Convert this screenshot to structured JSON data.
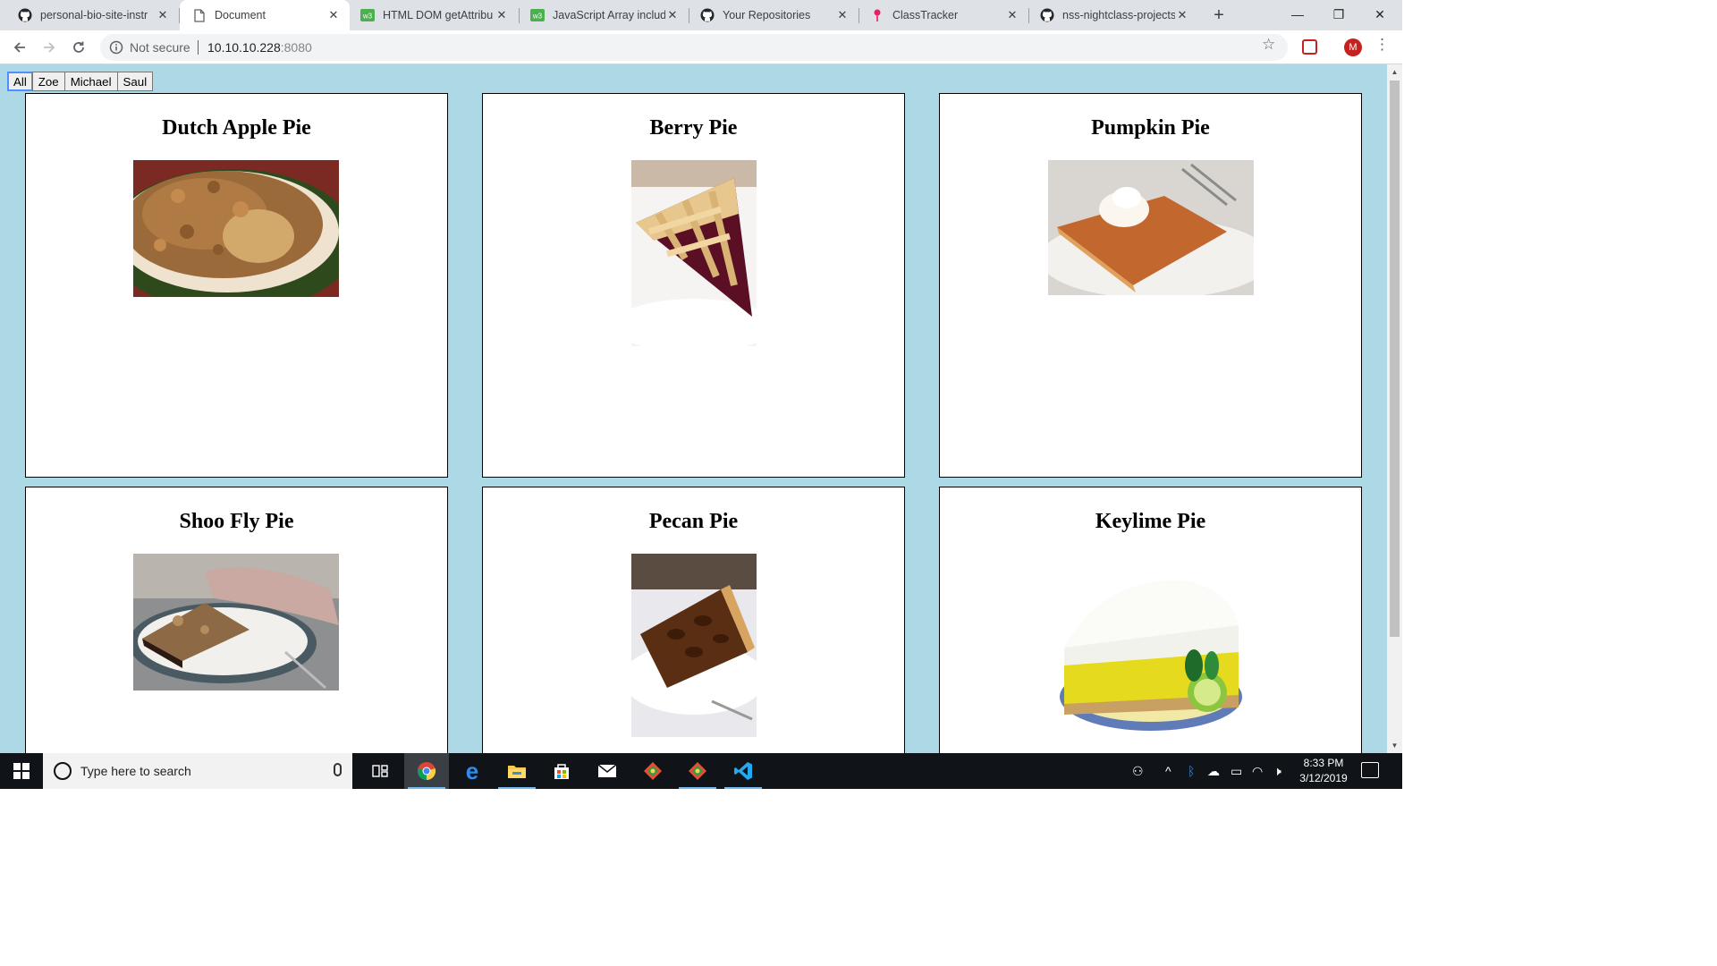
{
  "browser": {
    "tabs": [
      {
        "title": "personal-bio-site-instr",
        "icon": "github-icon",
        "active": false
      },
      {
        "title": "Document",
        "icon": "document-icon",
        "active": true
      },
      {
        "title": "HTML DOM getAttribu",
        "icon": "w3schools-icon",
        "active": false
      },
      {
        "title": "JavaScript Array includ",
        "icon": "w3schools-icon",
        "active": false
      },
      {
        "title": "Your Repositories",
        "icon": "github-icon",
        "active": false
      },
      {
        "title": "ClassTracker",
        "icon": "classtracker-icon",
        "active": false
      },
      {
        "title": "nss-nightclass-projects",
        "icon": "github-icon",
        "active": false
      }
    ],
    "close_glyph": "✕",
    "new_tab_glyph": "+",
    "window_controls": {
      "minimize": "—",
      "maximize": "❐",
      "close": "✕"
    },
    "address_bar": {
      "security_label": "Not secure",
      "host": "10.10.10.228",
      "port": ":8080"
    },
    "profile_initial": "M"
  },
  "page": {
    "filters": [
      {
        "label": "All",
        "active": true
      },
      {
        "label": "Zoe",
        "active": false
      },
      {
        "label": "Michael",
        "active": false
      },
      {
        "label": "Saul",
        "active": false
      }
    ],
    "pies": [
      {
        "name": "Dutch Apple Pie",
        "image": "dutch-apple-pie-photo"
      },
      {
        "name": "Berry Pie",
        "image": "berry-pie-photo"
      },
      {
        "name": "Pumpkin Pie",
        "image": "pumpkin-pie-photo"
      },
      {
        "name": "Shoo Fly Pie",
        "image": "shoo-fly-pie-photo"
      },
      {
        "name": "Pecan Pie",
        "image": "pecan-pie-photo"
      },
      {
        "name": "Keylime Pie",
        "image": "keylime-pie-photo"
      }
    ]
  },
  "taskbar": {
    "search_placeholder": "Type here to search",
    "apps": [
      "task-view-icon",
      "chrome-icon",
      "edge-icon",
      "file-explorer-icon",
      "store-icon",
      "mail-icon",
      "git-icon",
      "git-icon",
      "vscode-icon"
    ],
    "clock_time": "8:33 PM",
    "clock_date": "3/12/2019"
  },
  "colors": {
    "page_background": "#add8e6",
    "taskbar": "#101418",
    "tab_strip": "#dee1e6"
  }
}
